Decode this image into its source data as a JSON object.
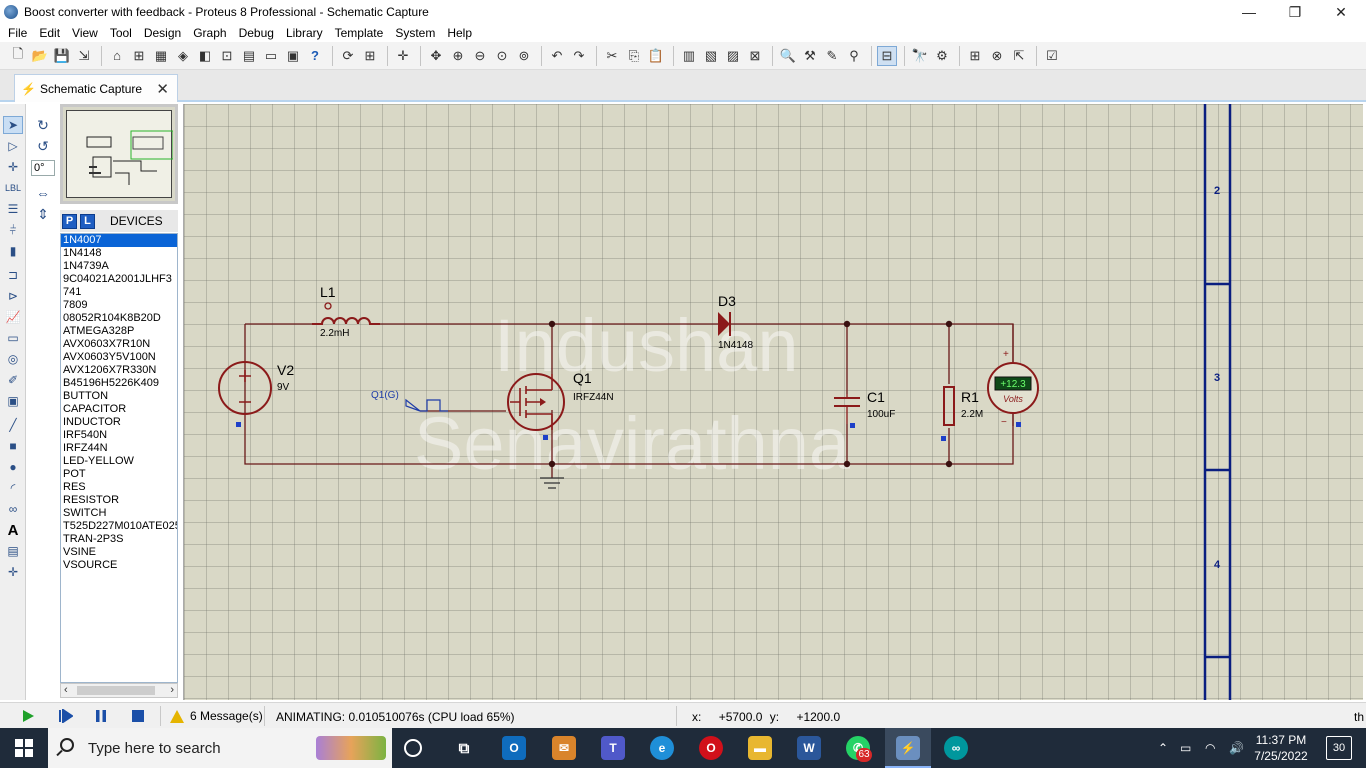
{
  "window": {
    "title": "Boost converter with feedback - Proteus 8 Professional - Schematic Capture",
    "minimize": "—",
    "maximize": "❐",
    "close": "✕"
  },
  "menu": [
    "File",
    "Edit",
    "View",
    "Tool",
    "Design",
    "Graph",
    "Debug",
    "Library",
    "Template",
    "System",
    "Help"
  ],
  "tab": {
    "label": "Schematic Capture",
    "close": "✕"
  },
  "rotation": {
    "angle": "0°"
  },
  "devices": {
    "p_label": "P",
    "l_label": "L",
    "title": "DEVICES",
    "selected_index": 0,
    "items": [
      "1N4007",
      "1N4148",
      "1N4739A",
      "9C04021A2001JLHF3",
      "741",
      "7809",
      "08052R104K8B20D",
      "ATMEGA328P",
      "AVX0603X7R10N",
      "AVX0603Y5V100N",
      "AVX1206X7R330N",
      "B45196H5226K409",
      "BUTTON",
      "CAPACITOR",
      "INDUCTOR",
      "IRF540N",
      "IRFZ44N",
      "LED-YELLOW",
      "POT",
      "RES",
      "RESISTOR",
      "SWITCH",
      "T525D227M010ATE025",
      "TRAN-2P3S",
      "VSINE",
      "VSOURCE"
    ]
  },
  "schematic": {
    "components": {
      "L1": {
        "ref": "L1",
        "value": "2.2mH"
      },
      "D3": {
        "ref": "D3",
        "value": "1N4148"
      },
      "V2": {
        "ref": "V2",
        "value": "9V"
      },
      "Q1": {
        "ref": "Q1",
        "value": "IRFZ44N"
      },
      "gen": {
        "label": "Q1(G)"
      },
      "C1": {
        "ref": "C1",
        "value": "100uF"
      },
      "R1": {
        "ref": "R1",
        "value": "2.2M"
      },
      "voltmeter": {
        "reading": "+12.3",
        "unit": "Volts",
        "plus": "+",
        "minus": "−"
      }
    },
    "watermark": [
      "Indushan",
      "Senavirathna"
    ],
    "frame_zones": [
      "2",
      "3",
      "4"
    ]
  },
  "status": {
    "messages": "6 Message(s)",
    "animating": "ANIMATING: 0.010510076s (CPU load 65%)",
    "coord_x_label": "x:",
    "coord_x": "+5700.0",
    "coord_y_label": "y:",
    "coord_y": "+1200.0",
    "units": "th"
  },
  "taskbar": {
    "search_placeholder": "Type here to search",
    "time": "11:37 PM",
    "date": "7/25/2022",
    "notifications": "30",
    "whatsapp_badge": "63"
  },
  "colors": {
    "wire": "#7a1515",
    "component": "#8b1a1a",
    "accent": "#0a64d6",
    "frame": "#0a1e80"
  }
}
